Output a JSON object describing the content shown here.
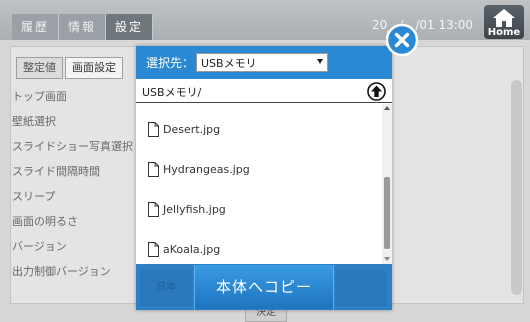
{
  "header": {
    "tabs": [
      "履歴",
      "情報",
      "設定"
    ],
    "active_tab_index": 2,
    "datetime": "20__/__/01 13:00",
    "home_label": "Home"
  },
  "settings": {
    "subtabs": [
      "整定値",
      "画面設定"
    ],
    "items": [
      "トップ画面",
      "壁紙選択",
      "スライドショー写真選択",
      "スライド間隔時間",
      "スリープ",
      "画面の明るさ",
      "バージョン",
      "出力制御バージョン"
    ],
    "decide_label": "決定"
  },
  "modal": {
    "dest_label": "選択先：",
    "dest_value": "USBメモリ",
    "path": "USBメモリ/",
    "files": [
      "Desert.jpg",
      "Hydrangeas.jpg",
      "Jellyfish.jpg",
      "aKoala.jpg"
    ],
    "footer_left_label": "日本",
    "copy_label": "本体へコピー",
    "scroll_position": 0.5
  },
  "colors": {
    "accent_blue": "#2a89d2",
    "header_gray": "#a9afb3"
  },
  "icons": [
    "home-icon",
    "up-arrow-icon",
    "file-icon",
    "close-icon",
    "dropdown-arrow-icon"
  ]
}
